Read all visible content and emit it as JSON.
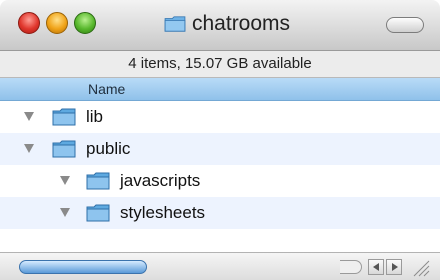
{
  "window": {
    "title": "chatrooms",
    "title_icon": "folder-icon",
    "status_text": "4 items, 15.07 GB available"
  },
  "list": {
    "column_header": "Name",
    "items": [
      {
        "label": "lib",
        "icon": "folder-icon",
        "expanded": false
      },
      {
        "label": "public",
        "icon": "folder-icon",
        "expanded": true
      },
      {
        "label": "javascripts",
        "icon": "folder-icon",
        "expanded": false
      },
      {
        "label": "stylesheets",
        "icon": "folder-icon",
        "expanded": false
      }
    ]
  },
  "colors": {
    "header_blue": "#8fc1ea",
    "folder_blue": "#5ea9e0",
    "alt_row": "#edf3fe",
    "close": "#e0362c",
    "minimize": "#f0a318",
    "zoom": "#58b82d"
  }
}
